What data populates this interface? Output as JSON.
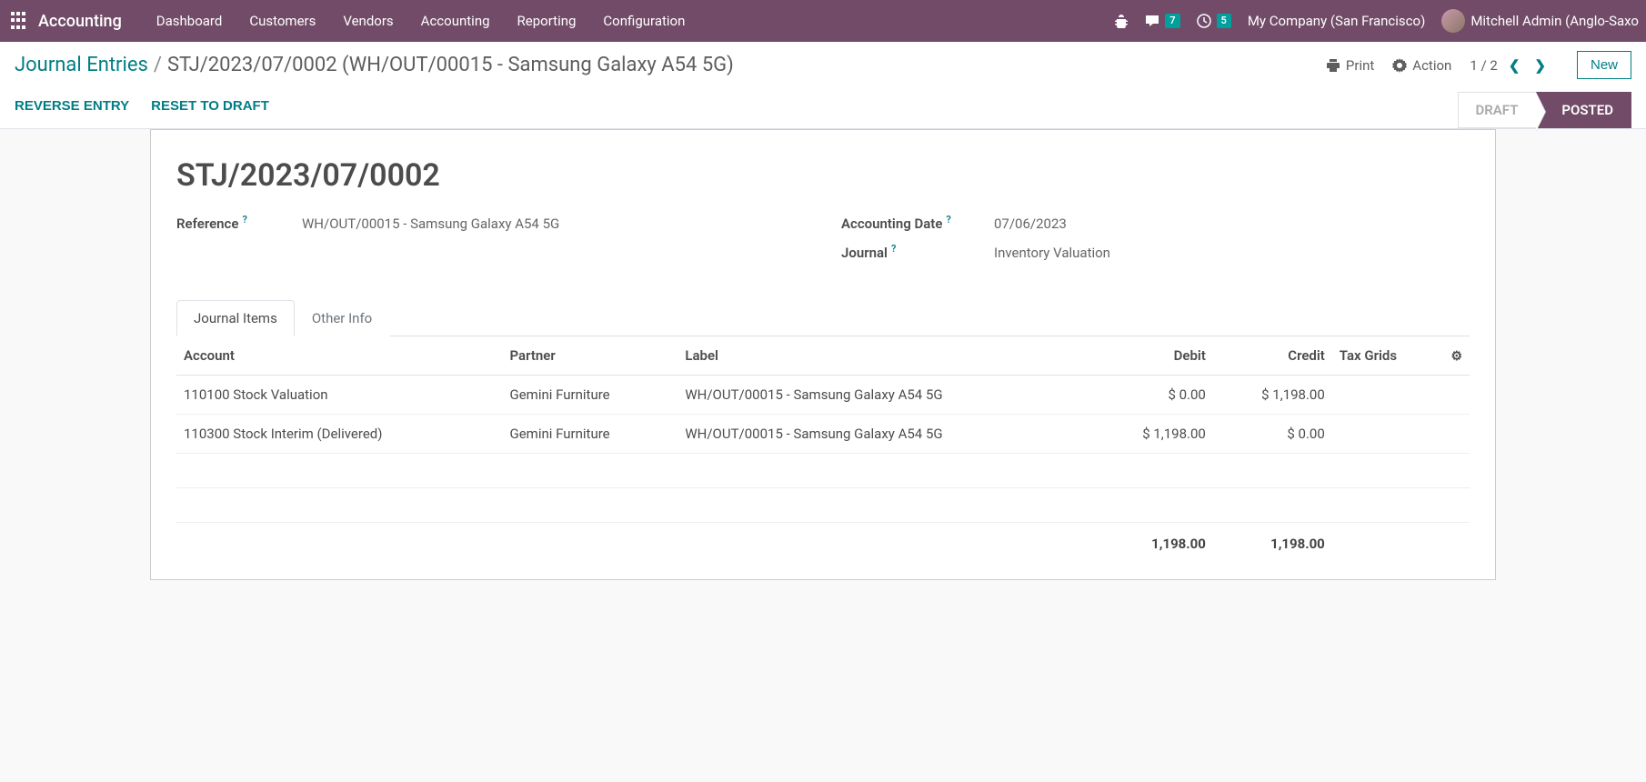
{
  "navbar": {
    "brand": "Accounting",
    "menu": [
      "Dashboard",
      "Customers",
      "Vendors",
      "Accounting",
      "Reporting",
      "Configuration"
    ],
    "messages_badge": "7",
    "activities_badge": "5",
    "company": "My Company (San Francisco)",
    "user": "Mitchell Admin (Anglo-Saxo"
  },
  "breadcrumb": {
    "parent": "Journal Entries",
    "current": "STJ/2023/07/0002 (WH/OUT/00015 - Samsung Galaxy A54 5G)"
  },
  "cp": {
    "print": "Print",
    "action": "Action",
    "pager": "1 / 2",
    "new_btn": "New",
    "reverse": "REVERSE ENTRY",
    "reset": "RESET TO DRAFT",
    "status_draft": "DRAFT",
    "status_posted": "POSTED"
  },
  "entry": {
    "name": "STJ/2023/07/0002",
    "reference_label": "Reference",
    "reference": "WH/OUT/00015 - Samsung Galaxy A54 5G",
    "date_label": "Accounting Date",
    "date": "07/06/2023",
    "journal_label": "Journal",
    "journal": "Inventory Valuation"
  },
  "tabs": {
    "journal_items": "Journal Items",
    "other_info": "Other Info"
  },
  "table": {
    "headers": {
      "account": "Account",
      "partner": "Partner",
      "label": "Label",
      "debit": "Debit",
      "credit": "Credit",
      "tax": "Tax Grids"
    },
    "rows": [
      {
        "account": "110100 Stock Valuation",
        "partner": "Gemini Furniture",
        "label": "WH/OUT/00015 - Samsung Galaxy A54 5G",
        "debit": "$ 0.00",
        "credit": "$ 1,198.00",
        "tax": ""
      },
      {
        "account": "110300 Stock Interim (Delivered)",
        "partner": "Gemini Furniture",
        "label": "WH/OUT/00015 - Samsung Galaxy A54 5G",
        "debit": "$ 1,198.00",
        "credit": "$ 0.00",
        "tax": ""
      }
    ],
    "totals": {
      "debit": "1,198.00",
      "credit": "1,198.00"
    }
  }
}
